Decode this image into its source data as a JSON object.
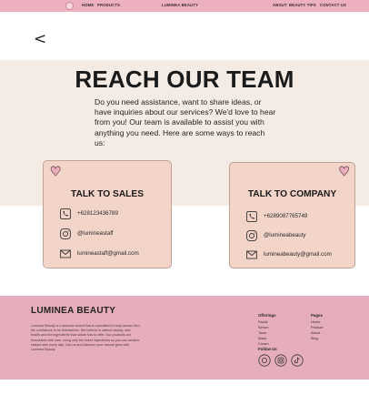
{
  "nav": {
    "home": "HOME",
    "products": "PRODUCTS",
    "brand": "LUMINEA BEAUTY",
    "about": "ABOUT",
    "beauty_tips": "BEAUTY TIPS",
    "contact": "CONTACT US"
  },
  "back_glyph": "<",
  "hero": {
    "title": "REACH OUR TEAM",
    "description": "Do you need assistance, want to share ideas, or have inquiries about our services? We'd love to hear from you! Our team is available to assist you with anything you need. Here are some ways to reach us:"
  },
  "cards": [
    {
      "title": "TALK TO SALES",
      "phone": "+628123436789",
      "instagram": "@lumineastaff",
      "email": "lumineastaff@gmail.com"
    },
    {
      "title": "TALK TO COMPANY",
      "phone": "+6289087765749",
      "instagram": "@lumineabeauty",
      "email": "lumineabeauty@gmail.com"
    }
  ],
  "footer": {
    "brand": "LUMINEA BEAUTY",
    "blurb": "Luminea Beauty is a skincare brand that is committed to help women find the confidence to be themselves. We believe in natural beauty, skin health and the ingredients that nature has to offer. Our products are formulated with care, using only the finest ingredients so you can achieve radiant skin every day. Join us and discover your natural glow with Luminea Beauty.",
    "offerings_heading": "Offerings",
    "offerings": [
      "Facial",
      "Serum",
      "Toner",
      "Mask",
      "Cream"
    ],
    "pages_heading": "Pages",
    "pages": [
      "Home",
      "Product",
      "About",
      "Blog"
    ],
    "social_heading": "Follow Us",
    "icons": [
      "web-icon",
      "instagram-icon",
      "tiktok-icon"
    ]
  },
  "colors": {
    "pink": "#ecb0bf",
    "cream": "#f4ece4",
    "card": "#f3d4c8"
  }
}
